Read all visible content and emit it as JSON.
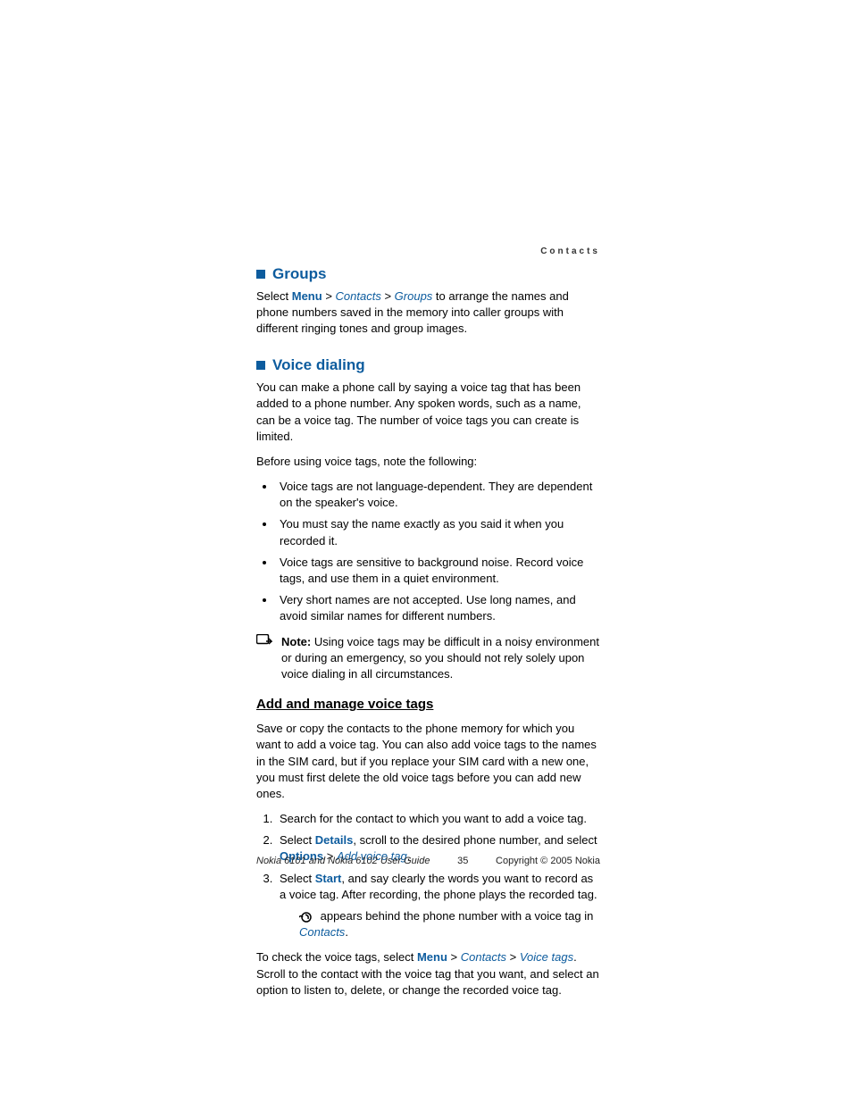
{
  "header": {
    "section": "Contacts"
  },
  "groups": {
    "title": "Groups",
    "select": "Select ",
    "menu": "Menu",
    "gt": " > ",
    "contacts": "Contacts",
    "groups_link": "Groups",
    "after": " to arrange the names and phone numbers saved in the memory into caller groups with different ringing tones and group images."
  },
  "voice": {
    "title": "Voice dialing",
    "intro": "You can make a phone call by saying a voice tag that has been added to a phone number. Any spoken words, such as a name, can be a voice tag. The number of voice tags you can create is limited.",
    "before": "Before using voice tags, note the following:",
    "bullets": [
      "Voice tags are not language-dependent. They are dependent on the speaker's voice.",
      "You must say the name exactly as you said it when you recorded it.",
      "Voice tags are sensitive to background noise. Record voice tags, and use them in a quiet environment.",
      "Very short names are not accepted. Use long names, and avoid similar names for different numbers."
    ],
    "note_label": "Note:",
    "note_text": " Using voice tags may be difficult in a noisy environment or during an emergency, so you should not rely solely upon voice dialing in all circumstances."
  },
  "manage": {
    "title": "Add and manage voice tags",
    "intro": "Save or copy the contacts to the phone memory for which you want to add a voice tag. You can also add voice tags to the names in the SIM card, but if you replace your SIM card with a new one, you must first delete the old voice tags before you can add new ones.",
    "step1": "Search for the contact to which you want to add a voice tag.",
    "step2_a": "Select ",
    "step2_details": "Details",
    "step2_b": ", scroll to the desired phone number, and select ",
    "step2_options": "Options",
    "step2_c": " > ",
    "step2_add": "Add voice tag",
    "step2_d": ".",
    "step3_a": "Select ",
    "step3_start": "Start",
    "step3_b": ", and say clearly the words you want to record as a voice tag. After recording, the phone plays the recorded tag.",
    "icon_line_a": " appears behind the phone number with a voice tag in ",
    "icon_line_contacts": "Contacts",
    "icon_line_b": ".",
    "check_a": "To check the voice tags, select ",
    "check_menu": "Menu",
    "check_gt": " > ",
    "check_contacts": "Contacts",
    "check_voicetags": "Voice tags",
    "check_b": ". Scroll to the contact with the voice tag that you want, and select an option to listen to, delete, or change the recorded voice tag."
  },
  "footer": {
    "left": "Nokia 6101 and Nokia 6102 User Guide",
    "center": "35",
    "right": "Copyright © 2005 Nokia"
  }
}
